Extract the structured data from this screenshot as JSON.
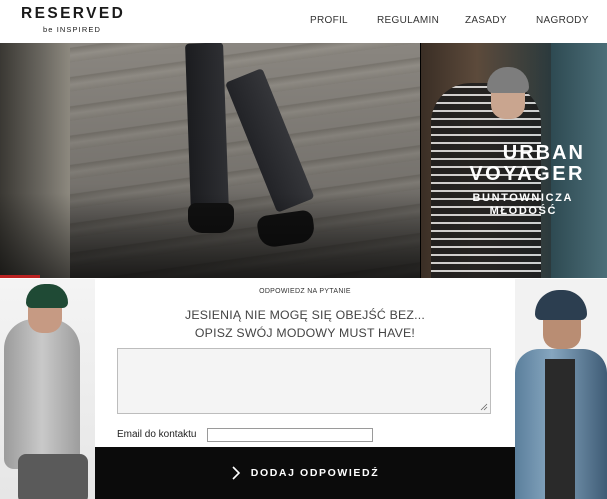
{
  "brand": {
    "name": "RESERVED",
    "tagline_prefix": "be",
    "tagline_main": "INSPIRED"
  },
  "nav": {
    "items": [
      {
        "label": "PROFIL"
      },
      {
        "label": "REGULAMIN"
      },
      {
        "label": "ZASADY"
      },
      {
        "label": "NAGRODY"
      }
    ]
  },
  "hero": {
    "title_line1": "URBAN",
    "title_line2": "VOYAGER",
    "subtitle_line1": "BUNTOWNICZA",
    "subtitle_line2": "MŁODOŚĆ"
  },
  "form": {
    "kicker": "ODPOWIEDZ NA PYTANIE",
    "question_line1": "JESIENIĄ NIE MOGĘ SIĘ OBEJŚĆ BEZ...",
    "question_line2": "OPISZ SWÓJ MODOWY MUST HAVE!",
    "answer_value": "",
    "email_label": "Email do kontaktu",
    "email_value": "",
    "submit_label": "DODAJ ODPOWIEDŹ"
  },
  "colors": {
    "submit_bg": "#0b0b0b",
    "text_dark": "#1a1a1a"
  },
  "icons": {
    "submit": "chevron-right-icon",
    "textarea": "resize-grip-icon"
  }
}
